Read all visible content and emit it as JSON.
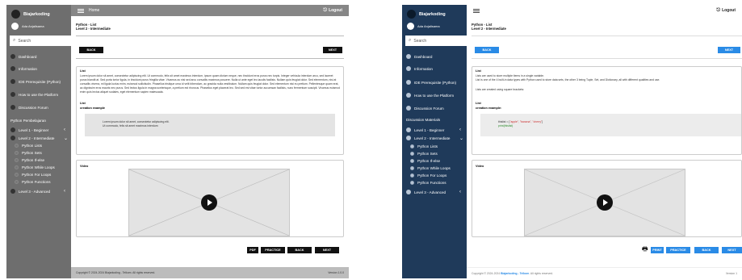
{
  "common": {
    "brand": "Biajarkoding",
    "user": "Ada Anjalisama",
    "search_placeholder": "Search",
    "logout": "Logout",
    "back": "BACK",
    "next": "NEXT",
    "practice": "PRACTICE",
    "course": "Python - List",
    "level_line": "Level 2 - Intermediate",
    "video_title": "Video"
  },
  "wireframe": {
    "top_title": "Home",
    "nav": [
      "Dashboard",
      "Information",
      "IDE Prerequisite (Python)",
      "How to use the Platform",
      "Discussion Forum"
    ],
    "section": "Python Pembelajaran",
    "levels": [
      "Level 1 - Beginner",
      "Level 2 - Intermediate",
      "Level 3 - Advanced"
    ],
    "sub": [
      "Python Lists",
      "Python Sets",
      "Python If-else",
      "Python While Loops",
      "Python For Loops",
      "Python Functions"
    ],
    "card_title": "List",
    "para": "Lorem ipsum dolor sit amet, consectetur adipiscing elit. Ut commodo, felis sit amet maximus interdum, ipsum quam dictum neque, nec tincidunt eros purus nec turpis. Integer vehicula interdum arcu, sed laoreet purus blandit at. Sed porta tortor ligula, in tincidunt purus fringilla vitae. Vivamus ac nisi sed arcu convallis maximus posuere. Nulla ut ante eget leo iaculis facilisis. Nullam quis feugiat dolor. Sed elementum, nisi at convallis viverra, mi ligula luctus enim, euismod sollicitudin. Phasellus tristique urna id velit bibendum, ac gravida nulla vestibulum. Nullam quis feugiat dolor. Sed elementum nisi eu pretium. Pellentesque quam erat, ac dignissim eros mauris nec purus. Sed lectus ligula in magna scelerisque, a pretium est rhoncus. Phasellus eget placerat leo. Sed sed est vitae tortor accumsan facilisis, nunc fermentum suscipit. Vivamus euismod enim quis lectus aliquet sodales, eget elementum sapien malesuada.",
    "sub_title": "List",
    "sub_caption": "creation example",
    "code1": "Lorem ipsum dolor sit amet, consectetur adipiscing elit.",
    "code2": "Ut commodo, felis sit amet maximus interdum",
    "pdf": "PDF",
    "footer_left": "Copyright © 2024-2024 Biajarkoding - Telkom. All rights reserved.",
    "footer_right": "Version 1.0.0"
  },
  "hifi": {
    "nav": [
      "Dashboard",
      "Information",
      "IDE Prerequisite (Python)",
      "How to use the Platform",
      "Discussion Forum"
    ],
    "section": "Discussion Materials",
    "levels": [
      "Level 1 - Beginner",
      "Level 2 - Intermediate",
      "Level 3 - Advanced"
    ],
    "sub": [
      "Python Lists",
      "Python Sets",
      "Python If-else",
      "Python While Loops",
      "Python For Loops",
      "Python Functions"
    ],
    "card_title": "List",
    "para1": "Lists are used to store multiple items in a single variable.",
    "para2": "List is one of the 4 built-in data types with Python used to store data sets, the other 3 being Tuple, Set, and Dictionary, all with different qualities and use.",
    "para3": "Lists are created using square brackets:",
    "sub_title": "List",
    "sub_caption": "creation example:",
    "code_var": "thislist = [",
    "code_vals": "\"apple\", \"banana\", \"cherry\"",
    "code_end": "]",
    "code2": "print(thislist)",
    "print": "PRINT",
    "footer_prefix": "Copyright © 2024-2024",
    "footer_brand": "Biajarkoding - Telkom",
    "footer_suffix": ". All rights reserved.",
    "footer_right": "Version 1"
  }
}
